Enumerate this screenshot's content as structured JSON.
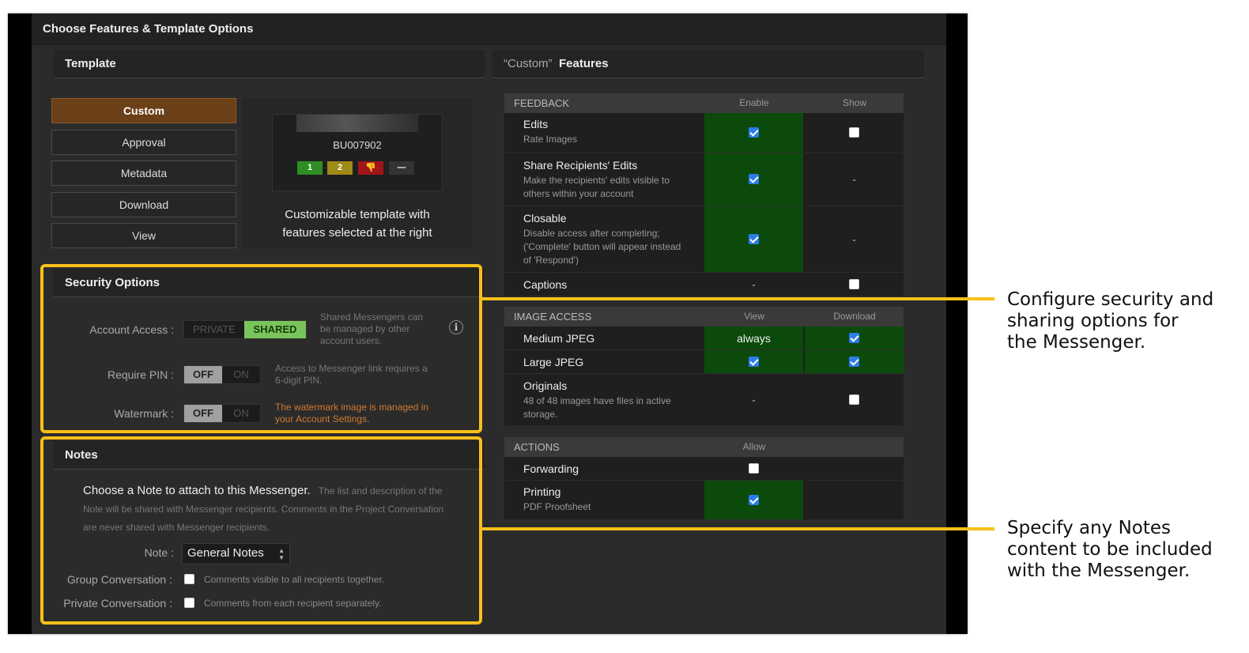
{
  "window": {
    "title": "Choose Features & Template Options"
  },
  "template": {
    "heading": "Template",
    "buttons": [
      "Custom",
      "Approval",
      "Metadata",
      "Download",
      "View"
    ],
    "active": "Custom",
    "preview": {
      "code": "BU007902",
      "ratings": [
        "1",
        "2",
        "👎",
        "—"
      ],
      "caption_line1": "Customizable template with",
      "caption_line2": "features selected at the right"
    }
  },
  "security": {
    "heading": "Security Options",
    "account_access": {
      "label": "Account Access :",
      "options": [
        "PRIVATE",
        "SHARED"
      ],
      "selected": "SHARED",
      "desc_line1": "Shared Messengers can",
      "desc_line2": "be managed by other",
      "desc_line3": "account users."
    },
    "info_icon": "i",
    "require_pin": {
      "label": "Require PIN :",
      "options": [
        "OFF",
        "ON"
      ],
      "selected": "OFF",
      "desc_line1": "Access to Messenger link requires a",
      "desc_line2": "6-digit PIN."
    },
    "watermark": {
      "label": "Watermark :",
      "options": [
        "OFF",
        "ON"
      ],
      "selected": "OFF",
      "desc_line1": "The watermark image is managed in",
      "desc_line2": "your Account Settings."
    }
  },
  "notes": {
    "heading": "Notes",
    "intro_strong": "Choose a Note to attach to this Messenger.",
    "intro_rest1": "The list and description of the",
    "intro_line2": "Note will be shared with Messenger recipients. Comments in the Project Conversation",
    "intro_line3": "are never shared with Messenger recipients.",
    "note_label": "Note :",
    "note_value": "General Notes",
    "group": {
      "label": "Group Conversation :",
      "desc": "Comments visible to all recipients together.",
      "checked": false
    },
    "private": {
      "label": "Private Conversation :",
      "desc": "Comments from each recipient separately.",
      "checked": false
    }
  },
  "features": {
    "heading_quote": "“Custom”",
    "heading_rest": "Features",
    "feedback": {
      "title": "FEEDBACK",
      "col1": "Enable",
      "col2": "Show",
      "rows": [
        {
          "name": "Edits",
          "sub": "Rate Images",
          "c1": true,
          "c2": false
        },
        {
          "name": "Share Recipients' Edits",
          "sub1": "Make the recipients' edits visible to",
          "sub2": "others within your account",
          "c1": true,
          "c2": "-"
        },
        {
          "name": "Closable",
          "sub1": "Disable access after completing;",
          "sub2": "('Complete' button will appear instead",
          "sub3": "of 'Respond')",
          "c1": true,
          "c2": "-"
        },
        {
          "name": "Captions",
          "c1": "-",
          "c2": false
        }
      ]
    },
    "image_access": {
      "title": "IMAGE ACCESS",
      "col1": "View",
      "col2": "Download",
      "rows": [
        {
          "name": "Medium JPEG",
          "c1": "always",
          "c2": true
        },
        {
          "name": "Large JPEG",
          "c1": true,
          "c2": true
        },
        {
          "name": "Originals",
          "sub1": "48 of 48 images have files in active",
          "sub2": "storage.",
          "c1": "-",
          "c2": false
        }
      ]
    },
    "actions": {
      "title": "ACTIONS",
      "col1": "Allow",
      "rows": [
        {
          "name": "Forwarding",
          "c1": false
        },
        {
          "name": "Printing",
          "sub": "PDF Proofsheet",
          "c1": true
        }
      ]
    }
  },
  "annotations": {
    "security_line1": "Configure security and",
    "security_line2": "sharing options for",
    "security_line3": "the Messenger.",
    "notes_line1": "Specify any Notes",
    "notes_line2": "content to be included",
    "notes_line3": "with the Messenger."
  },
  "colors": {
    "accent_highlight": "#f7c01a",
    "enabled_cell": "#0c4a0c",
    "active_template": "#6b3f17",
    "shared_on": "#7ac45c"
  }
}
